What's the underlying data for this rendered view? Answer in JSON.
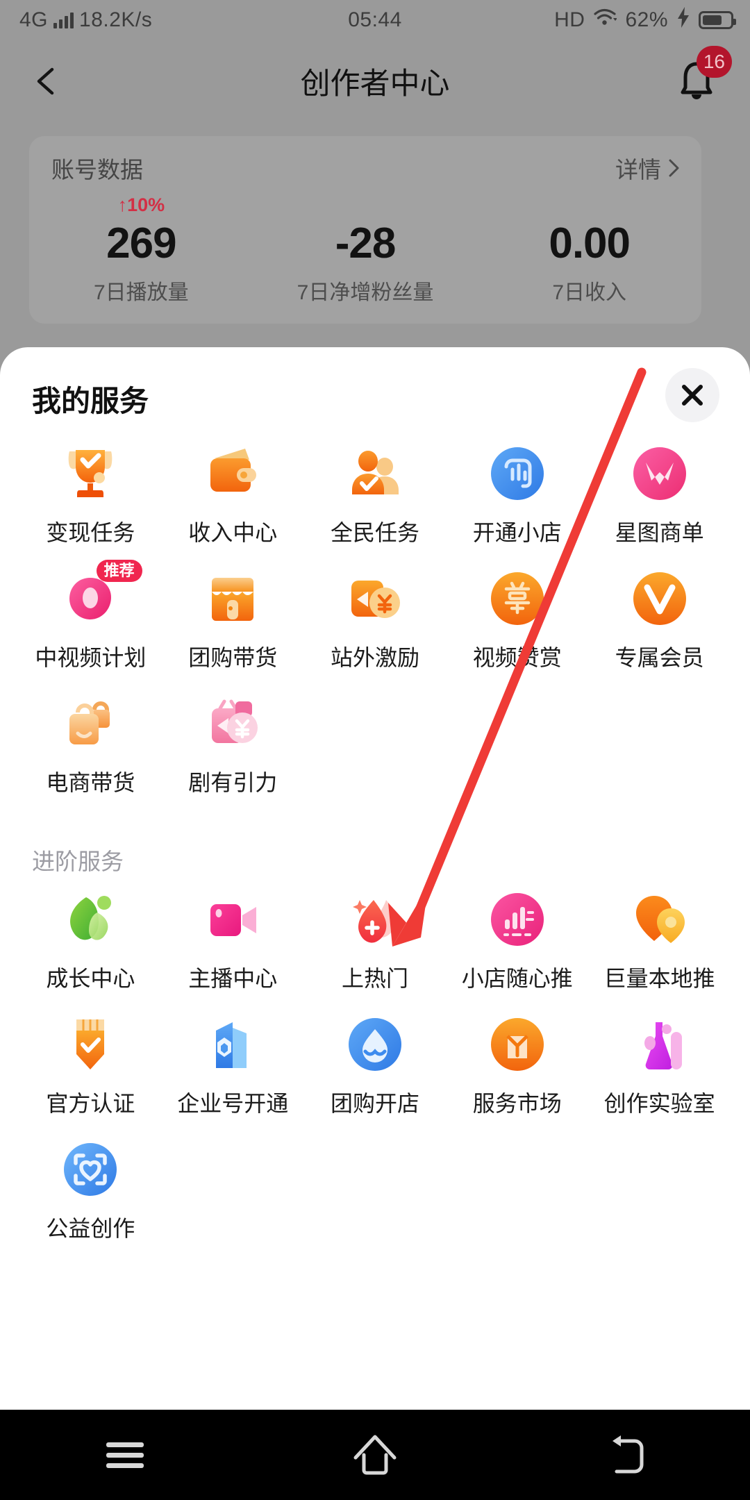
{
  "status_bar": {
    "network": "4G",
    "speed": "18.2K/s",
    "time": "05:44",
    "hd": "HD",
    "battery_percent": "62%",
    "signal_icon": "signal-bars-icon",
    "wifi_icon": "wifi-icon",
    "charging_icon": "lightning-bolt-icon",
    "battery_icon": "battery-icon"
  },
  "app_bar": {
    "back_icon": "back-chevron-icon",
    "title": "创作者中心",
    "bell_icon": "bell-icon",
    "badge_count": "16"
  },
  "data_card": {
    "title": "账号数据",
    "more_label": "详情",
    "more_icon": "chevron-right-icon",
    "stats": [
      {
        "delta": "↑10%",
        "value": "269",
        "label": "7日播放量"
      },
      {
        "delta": "",
        "value": "-28",
        "label": "7日净增粉丝量"
      },
      {
        "delta": "",
        "value": "0.00",
        "label": "7日收入"
      }
    ]
  },
  "sheet": {
    "title": "我的服务",
    "close_icon": "close-icon",
    "my_services": [
      {
        "label": "变现任务",
        "icon": "trophy-icon"
      },
      {
        "label": "收入中心",
        "icon": "wallet-icon"
      },
      {
        "label": "全民任务",
        "icon": "people-check-icon"
      },
      {
        "label": "开通小店",
        "icon": "shop-chart-icon"
      },
      {
        "label": "星图商单",
        "icon": "star-map-icon"
      },
      {
        "label": "中视频计划",
        "icon": "play-drop-icon",
        "badge": "推荐"
      },
      {
        "label": "团购带货",
        "icon": "storefront-icon"
      },
      {
        "label": "站外激励",
        "icon": "video-yuan-icon"
      },
      {
        "label": "视频赞赏",
        "icon": "reward-shang-icon"
      },
      {
        "label": "专属会员",
        "icon": "vip-v-icon"
      },
      {
        "label": "电商带货",
        "icon": "shopping-bag-icon"
      },
      {
        "label": "剧有引力",
        "icon": "drama-yuan-icon"
      }
    ],
    "advanced_section_title": "进阶服务",
    "advanced_services": [
      {
        "label": "成长中心",
        "icon": "leaf-growth-icon"
      },
      {
        "label": "主播中心",
        "icon": "video-camera-icon"
      },
      {
        "label": "上热门",
        "icon": "flame-plus-icon"
      },
      {
        "label": "小店随心推",
        "icon": "bar-chart-promo-icon"
      },
      {
        "label": "巨量本地推",
        "icon": "location-pins-icon"
      },
      {
        "label": "官方认证",
        "icon": "verified-badge-icon"
      },
      {
        "label": "企业号开通",
        "icon": "enterprise-building-icon"
      },
      {
        "label": "团购开店",
        "icon": "group-buy-drop-icon"
      },
      {
        "label": "服务市场",
        "icon": "service-market-icon"
      },
      {
        "label": "创作实验室",
        "icon": "lab-flask-icon"
      }
    ],
    "public_welfare": [
      {
        "label": "公益创作",
        "icon": "heart-scan-icon"
      }
    ]
  },
  "annotation": {
    "arrow_icon": "red-arrow-icon",
    "arrow_color": "#ef3b36"
  },
  "nav_bar": {
    "recents_icon": "menu-icon",
    "home_icon": "home-icon",
    "back_icon": "back-arrow-icon"
  },
  "colors": {
    "accent_orange": "#f6821f",
    "accent_pink": "#f0268c",
    "accent_blue": "#3a8ef0",
    "badge_red": "#b3152c",
    "delta_red": "#d32f45",
    "sheet_bg": "#ffffff",
    "backdrop": "#9a9a9a"
  }
}
